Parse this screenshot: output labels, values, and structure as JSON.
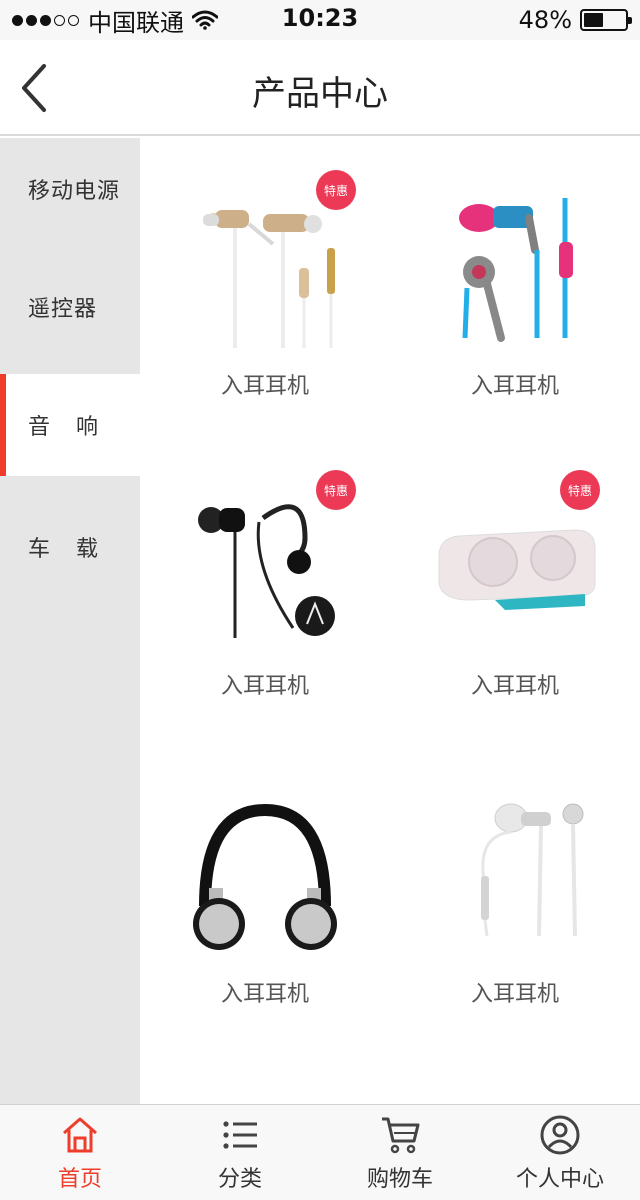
{
  "status_bar": {
    "carrier": "中国联通",
    "time": "10:23",
    "battery": "48%",
    "battery_level": 0.48
  },
  "header": {
    "title": "产品中心"
  },
  "sidebar": {
    "items": [
      {
        "label": "移动电源",
        "active": false
      },
      {
        "label": "遥控器",
        "active": false
      },
      {
        "label": "音响",
        "active": true
      },
      {
        "label": "车载",
        "active": false
      }
    ]
  },
  "products": [
    {
      "label": "入耳耳机",
      "badge": "特惠",
      "icon": "gold-earphones-icon"
    },
    {
      "label": "入耳耳机",
      "badge": "",
      "icon": "pink-blue-earphones-icon"
    },
    {
      "label": "入耳耳机",
      "badge": "特惠",
      "icon": "black-earphones-icon"
    },
    {
      "label": "入耳耳机",
      "badge": "特惠",
      "icon": "portable-speaker-icon"
    },
    {
      "label": "入耳耳机",
      "badge": "",
      "icon": "headphones-icon"
    },
    {
      "label": "入耳耳机",
      "badge": "",
      "icon": "white-earphones-icon"
    }
  ],
  "tabbar": {
    "items": [
      {
        "label": "首页",
        "icon": "home-icon",
        "active": true
      },
      {
        "label": "分类",
        "icon": "list-icon",
        "active": false
      },
      {
        "label": "购物车",
        "icon": "cart-icon",
        "active": false
      },
      {
        "label": "个人中心",
        "icon": "user-icon",
        "active": false
      }
    ]
  },
  "colors": {
    "accent": "#ef3d2c",
    "badge": "#ec3a56",
    "sidebar_bg": "#e6e6e6"
  }
}
